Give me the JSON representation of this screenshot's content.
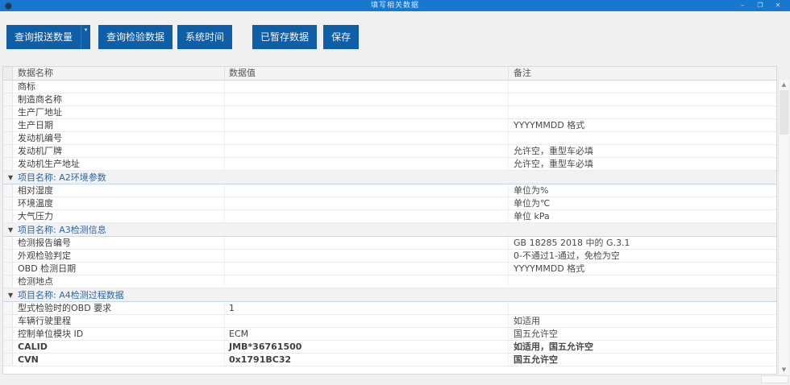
{
  "window": {
    "title": "填写相关数据",
    "controls": {
      "minimize": "–",
      "maximize": "❐",
      "close": "✕"
    }
  },
  "icons": {
    "dropdown_caret": "▾",
    "section_caret": "▼",
    "scroll_up": "▲",
    "scroll_down": "▼"
  },
  "colors": {
    "titlebar_blue": "#1878cf",
    "button_blue": "#0e5ea8",
    "section_text_blue": "#2b66a7"
  },
  "toolbar": {
    "buttons": [
      {
        "label": "查询报送数量",
        "has_dropdown": true
      },
      {
        "label": "查询检验数据"
      },
      {
        "label": "系统时间"
      },
      {
        "label": "已暂存数据"
      },
      {
        "label": "保存"
      }
    ]
  },
  "table": {
    "columns": [
      "数据名称",
      "数据值",
      "备注"
    ],
    "rows": [
      {
        "type": "data",
        "name": "商标",
        "value": "",
        "remark": ""
      },
      {
        "type": "data",
        "name": "制造商名称",
        "value": "",
        "remark": ""
      },
      {
        "type": "data",
        "name": "生产厂地址",
        "value": "",
        "remark": ""
      },
      {
        "type": "data",
        "name": "生产日期",
        "value": "",
        "remark": "YYYYMMDD 格式"
      },
      {
        "type": "data",
        "name": "发动机编号",
        "value": "",
        "remark": ""
      },
      {
        "type": "data",
        "name": "发动机厂牌",
        "value": "",
        "remark": "允许空，重型车必填"
      },
      {
        "type": "data",
        "name": "发动机生产地址",
        "value": "",
        "remark": "允许空，重型车必填"
      },
      {
        "type": "section",
        "name": "项目名称: A2环境参数"
      },
      {
        "type": "data",
        "name": "相对湿度",
        "value": "",
        "remark": "单位为%"
      },
      {
        "type": "data",
        "name": "环境温度",
        "value": "",
        "remark": "单位为℃"
      },
      {
        "type": "data",
        "name": "大气压力",
        "value": "",
        "remark": "单位 kPa"
      },
      {
        "type": "section",
        "name": "项目名称: A3检测信息"
      },
      {
        "type": "data",
        "name": "检测报告编号",
        "value": "",
        "remark": "GB 18285 2018 中的 G.3.1"
      },
      {
        "type": "data",
        "name": "外观检验判定",
        "value": "",
        "remark": "0-不通过1-通过，免检为空"
      },
      {
        "type": "data",
        "name": "OBD 检测日期",
        "value": "",
        "remark": "YYYYMMDD 格式"
      },
      {
        "type": "data",
        "name": "检测地点",
        "value": "",
        "remark": ""
      },
      {
        "type": "section",
        "name": "项目名称: A4检测过程数据"
      },
      {
        "type": "data",
        "name": "型式检验时的OBD 要求",
        "value": "1",
        "remark": ""
      },
      {
        "type": "data",
        "name": "车辆行驶里程",
        "value": "",
        "remark": "如适用"
      },
      {
        "type": "data",
        "name": "控制单位模块 ID",
        "value": "ECM",
        "remark": "国五允许空"
      },
      {
        "type": "data",
        "name": "CALID",
        "value": "JMB*36761500",
        "remark": "如适用，国五允许空",
        "bold": true
      },
      {
        "type": "data",
        "name": "CVN",
        "value": "0x1791BC32",
        "remark": "国五允许空",
        "bold": true
      }
    ]
  }
}
